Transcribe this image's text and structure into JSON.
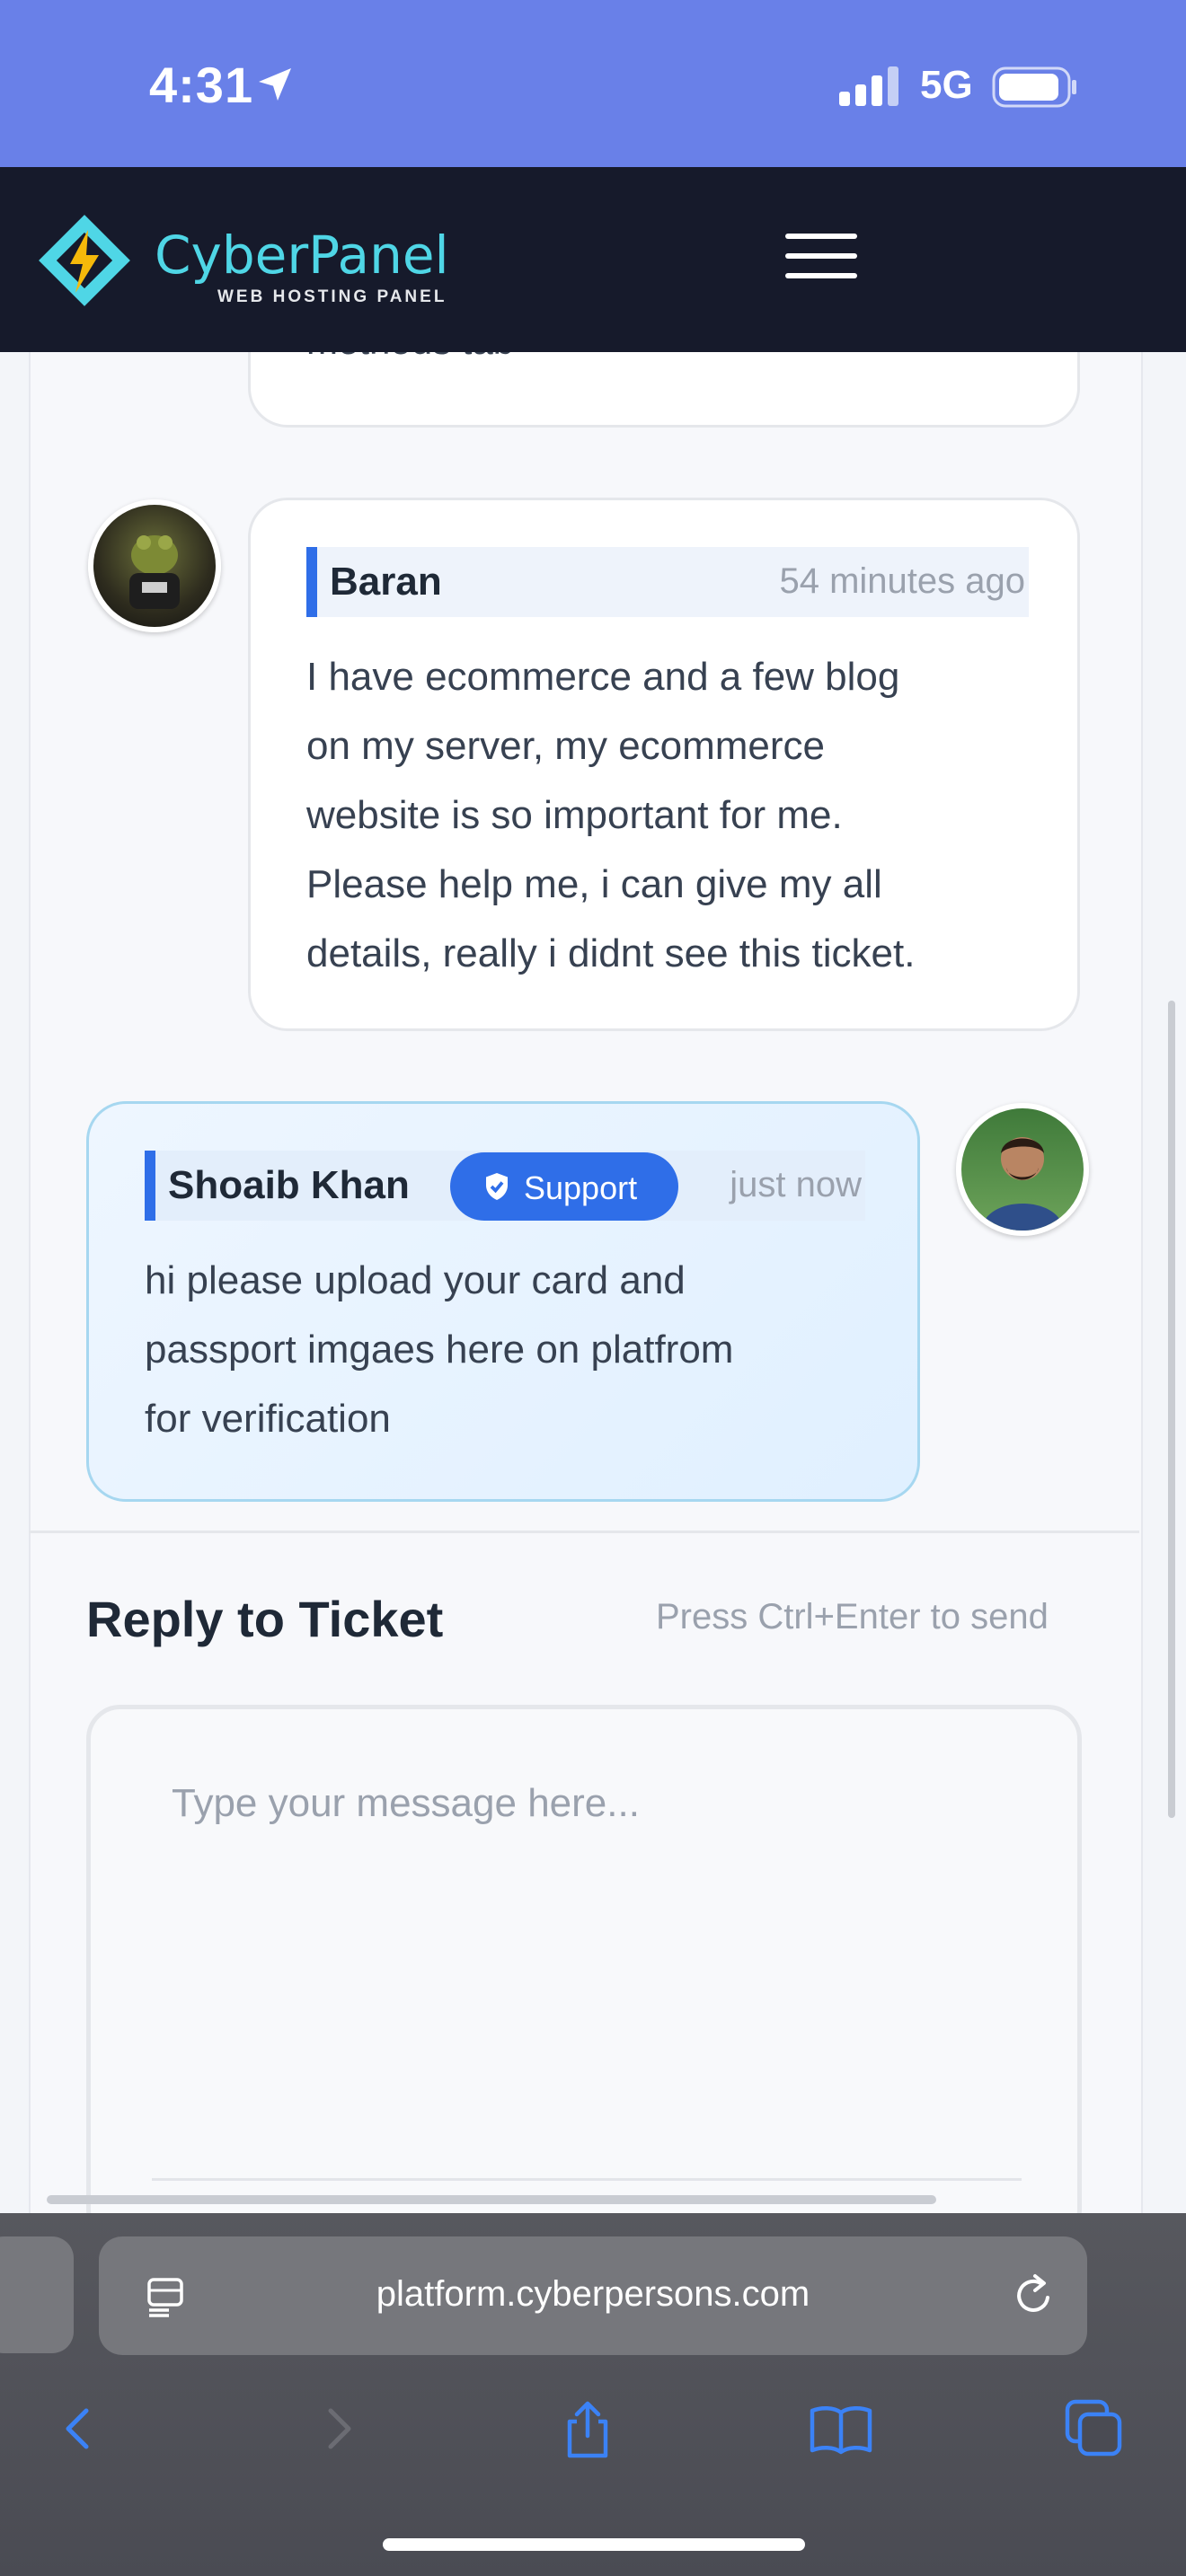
{
  "status": {
    "time": "4:31",
    "network": "5G"
  },
  "header": {
    "logo_title": "CyberPanel",
    "logo_subtitle": "WEB HOSTING PANEL"
  },
  "messages": [
    {
      "partial_text": "methods tab"
    },
    {
      "author": "Baran",
      "time": "54 minutes ago",
      "lines": [
        "I have ecommerce and a few blog",
        "on my server, my ecommerce",
        "website is so important for me.",
        "Please help me, i can give my all",
        "details, really i didnt see this ticket."
      ]
    },
    {
      "author": "Shoaib Khan",
      "badge": "Support",
      "time": "just now",
      "lines": [
        "hi please upload your card and",
        "passport imgaes here on platfrom",
        "for verification"
      ]
    }
  ],
  "reply": {
    "title": "Reply to Ticket",
    "hint": "Press Ctrl+Enter to send",
    "placeholder": "Type your message here..."
  },
  "browser": {
    "url": "platform.cyberpersons.com"
  },
  "colors": {
    "header_bg": "#161a2b",
    "status_bg": "#6980e8",
    "accent": "#2f6ee8",
    "logo": "#4fd6e6"
  }
}
